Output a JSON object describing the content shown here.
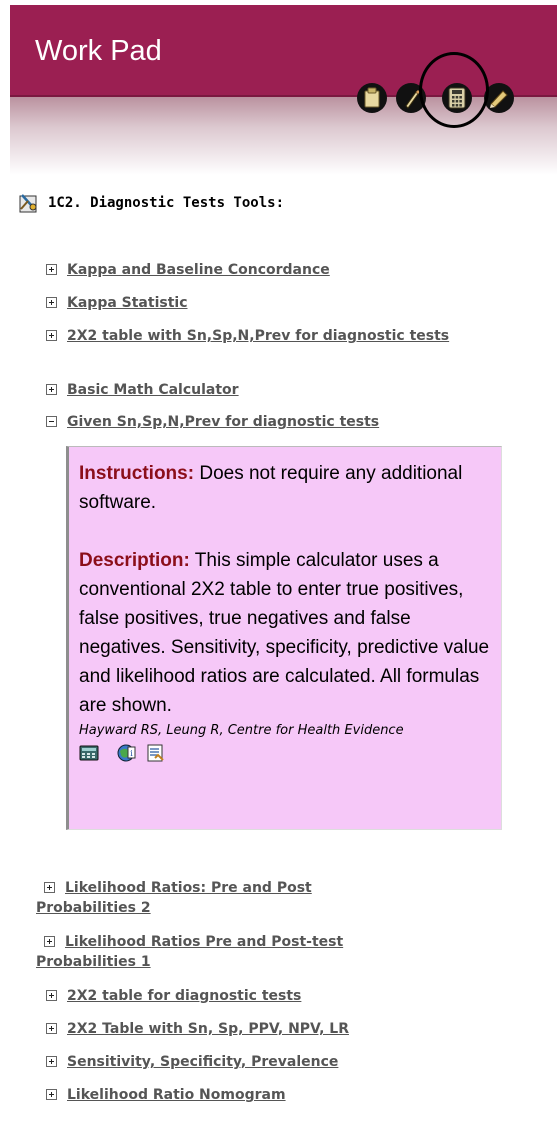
{
  "header": {
    "title": "Work Pad",
    "color": "#9b1f52",
    "tools": [
      {
        "icon": "clipboard-icon"
      },
      {
        "icon": "pen-icon"
      },
      {
        "icon": "calculator-icon"
      },
      {
        "icon": "pencil-icon"
      }
    ]
  },
  "section": {
    "title": "1C2. Diagnostic Tests Tools:",
    "icon": "tools-icon"
  },
  "items": [
    {
      "label": "Kappa and Baseline Concordance",
      "expanded": false
    },
    {
      "label": "Kappa Statistic",
      "expanded": false
    },
    {
      "label": "2X2 table with Sn,Sp,N,Prev for diagnostic tests",
      "expanded": false
    },
    {
      "label": "Basic Math Calculator",
      "expanded": false
    },
    {
      "label": "Given Sn,Sp,N,Prev for diagnostic tests",
      "expanded": true
    },
    {
      "label": "Likelihood Ratios: Pre and Post Probabilities 2",
      "expanded": false
    },
    {
      "label": "Likelihood Ratios Pre and Post-test Probabilities 1",
      "expanded": false
    },
    {
      "label": "2X2 table for diagnostic tests",
      "expanded": false
    },
    {
      "label": "2X2 Table with Sn, Sp, PPV, NPV, LR",
      "expanded": false
    },
    {
      "label": "Sensitivity, Specificity, Prevalence",
      "expanded": false
    },
    {
      "label": "Likelihood Ratio Nomogram",
      "expanded": false
    }
  ],
  "detail": {
    "instructions_label": "Instructions:",
    "instructions_text": "Does not require any additional software.",
    "description_label": "Description:",
    "description_text": "This simple calculator uses a conventional 2X2 table to enter true positives, false positives, true negatives and false negatives. Sensitivity, specificity, predictive value and likelihood ratios are calculated. All formulas are shown.",
    "citation": "Hayward RS, Leung R, Centre for Health Evidence",
    "background": "#f6c8f8",
    "icons": [
      "calculator-icon",
      "web-info-icon",
      "notepad-icon"
    ]
  }
}
